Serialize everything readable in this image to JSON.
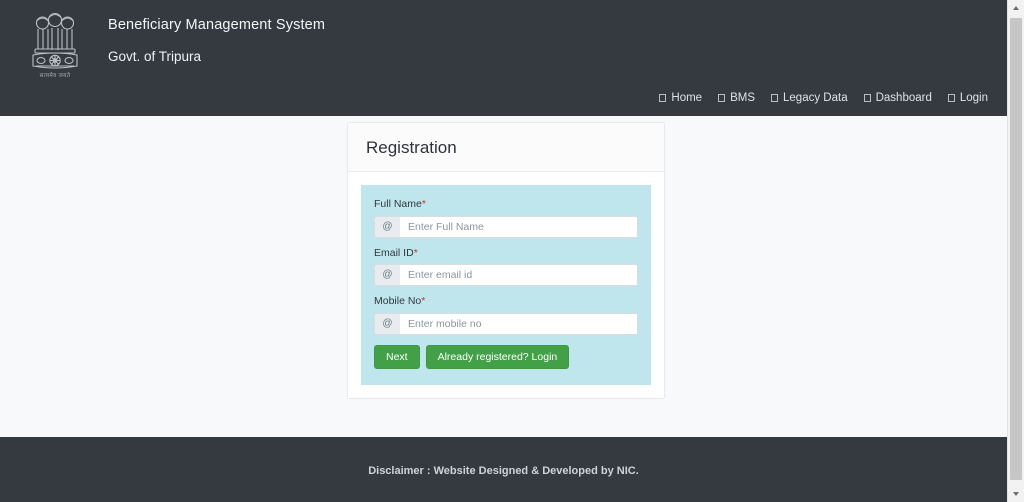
{
  "header": {
    "emblem_icon": "india-national-emblem-icon",
    "emblem_motto": "सत्यमेव जयते",
    "title": "Beneficiary Management System",
    "subtitle": "Govt. of Tripura",
    "nav": [
      {
        "label": "Home",
        "icon": "missing-glyph-box-icon"
      },
      {
        "label": "BMS",
        "icon": "missing-glyph-box-icon"
      },
      {
        "label": "Legacy Data",
        "icon": "missing-glyph-box-icon"
      },
      {
        "label": "Dashboard",
        "icon": "missing-glyph-box-icon"
      },
      {
        "label": "Login",
        "icon": "missing-glyph-box-icon"
      }
    ]
  },
  "registration": {
    "card_title": "Registration",
    "required_marker": "*",
    "fields": [
      {
        "label": "Full Name",
        "required": true,
        "addon_icon": "at-symbol-icon",
        "addon_text": "@",
        "placeholder": "Enter Full Name",
        "value": ""
      },
      {
        "label": "Email ID",
        "required": true,
        "addon_icon": "at-symbol-icon",
        "addon_text": "@",
        "placeholder": "Enter email id",
        "value": ""
      },
      {
        "label": "Mobile No",
        "required": true,
        "addon_icon": "at-symbol-icon",
        "addon_text": "@",
        "placeholder": "Enter mobile no",
        "value": ""
      }
    ],
    "buttons": {
      "next": "Next",
      "login": "Already registered? Login"
    }
  },
  "footer": {
    "disclaimer": "Disclaimer : Website Designed & Developed by NIC."
  },
  "scrollbar": {
    "up_arrow": "scroll-up-arrow-icon",
    "down_arrow": "scroll-down-arrow-icon"
  },
  "colors": {
    "header_bg": "#343a40",
    "footer_bg": "#343a40",
    "page_bg": "#f8f9fa",
    "panel_bg": "#bfe6ec",
    "button_green": "#42a047",
    "required_red": "#c0392b"
  }
}
